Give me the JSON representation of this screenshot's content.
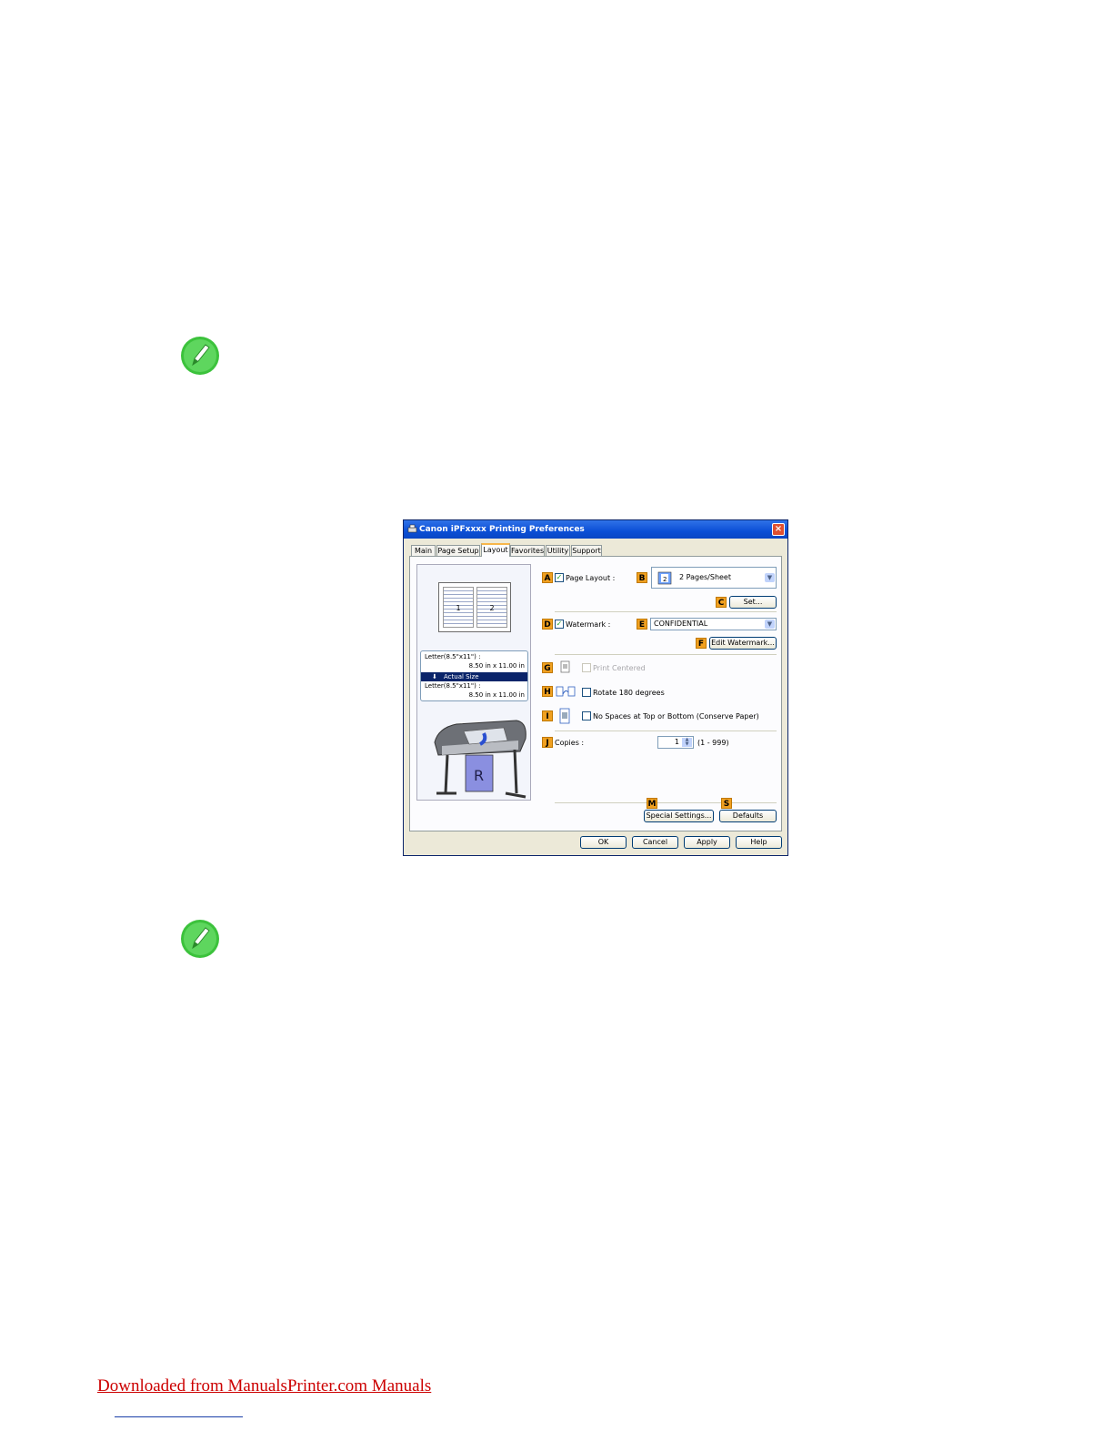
{
  "dialog": {
    "title": "Canon iPFxxxx Printing Preferences",
    "close": "×",
    "tabs": [
      "Main",
      "Page Setup",
      "Layout",
      "Favorites",
      "Utility",
      "Support"
    ],
    "active_tab": "Layout",
    "preview": {
      "page_numbers": [
        "1",
        "2"
      ],
      "input_paper": "Letter(8.5\"x11\") :",
      "input_size": "8.50 in x 11.00 in",
      "scaling": "Actual Size",
      "output_paper": "Letter(8.5\"x11\") :",
      "output_size": "8.50 in x 11.00 in"
    },
    "labels": {
      "A": "A",
      "B": "B",
      "C": "C",
      "D": "D",
      "E": "E",
      "F": "F",
      "G": "G",
      "H": "H",
      "I": "I",
      "J": "J",
      "M": "M",
      "S": "S"
    },
    "page_layout": {
      "label": "Page Layout :",
      "checked": true,
      "value": "2 Pages/Sheet"
    },
    "set_button": "Set...",
    "watermark": {
      "label": "Watermark :",
      "checked": true,
      "value": "CONFIDENTIAL"
    },
    "edit_watermark_button": "Edit Watermark...",
    "print_centered": {
      "label": "Print Centered",
      "checked": false,
      "enabled": false
    },
    "rotate": {
      "label": "Rotate 180 degrees",
      "checked": false
    },
    "no_spaces": {
      "label": "No Spaces at Top or Bottom (Conserve Paper)",
      "checked": false
    },
    "copies": {
      "label": "Copies :",
      "value": "1",
      "range": "(1 - 999)"
    },
    "special_settings_button": "Special Settings...",
    "defaults_button": "Defaults",
    "ok_button": "OK",
    "cancel_button": "Cancel",
    "apply_button": "Apply",
    "help_button": "Help"
  },
  "footer": {
    "link_text": "Downloaded from ManualsPrinter.com Manuals"
  },
  "icons": {
    "note": "pencil-note-icon"
  },
  "colors": {
    "note_green": "#3cc23c",
    "badge_orange": "#f0a020",
    "footer_red": "#cc0000",
    "titlebar_blue": "#0b4fd6"
  }
}
